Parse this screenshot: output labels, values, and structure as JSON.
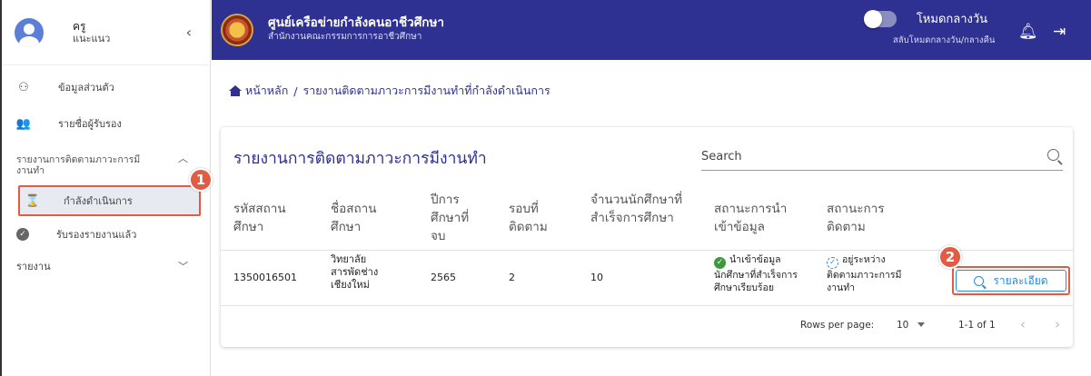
{
  "user": {
    "name": "ครู",
    "role": "แนะแนว"
  },
  "sidebar": {
    "items": [
      {
        "label": "ข้อมูลส่วนตัว",
        "icon": "user-settings-icon"
      },
      {
        "label": "รายชื่อผู้รับรอง",
        "icon": "people-icon"
      }
    ],
    "group": {
      "label": "รายงานการติดตามภาวะการมีงานทำ",
      "icon": "chevron-up-icon"
    },
    "sub_items": [
      {
        "label": "กำลังดำเนินการ",
        "icon": "hourglass-icon",
        "active": true
      },
      {
        "label": "รับรองรายงานแล้ว",
        "icon": "check-circle-icon"
      }
    ],
    "report": {
      "label": "รายงาน",
      "icon": "chevron-down-icon"
    }
  },
  "header": {
    "org_name": "ศูนย์เครือข่ายกำลังคนอาชีวศึกษา",
    "org_sub": "สำนักงานคณะกรรมการการอาชีวศึกษา",
    "mode_label": "โหมดกลางวัน",
    "mode_sub": "สลับโหมดกลางวัน/กลางคืน"
  },
  "breadcrumb": {
    "home": "หน้าหลัก",
    "separator": "/",
    "current": "รายงานติดตามภาวะการมีงานทำที่กำลังดำเนินการ"
  },
  "card": {
    "title": "รายงานการติดตามภาวะการมีงานทำ",
    "search_placeholder": "Search"
  },
  "table": {
    "headers": [
      "รหัสสถานศึกษา",
      "ชื่อสถานศึกษา",
      "ปีการศึกษาที่จบ",
      "รอบที่ติดตาม",
      "จำนวนนักศึกษาที่สำเร็จการศึกษา",
      "สถานะการนำเข้าข้อมูล",
      "สถานะการติดตาม"
    ],
    "rows": [
      {
        "code": "1350016501",
        "name": "วิทยาลัยสารพัดช่างเชียงใหม่",
        "year": "2565",
        "round": "2",
        "graduates": "10",
        "import_status": "นำเข้าข้อมูลนักศึกษาที่สำเร็จการศึกษาเรียบร้อย",
        "tracking_status": "อยู่ระหว่างติดตามภาวะการมีงานทำ",
        "detail_label": "รายละเอียด"
      }
    ],
    "footer": {
      "rows_per_page_label": "Rows per page:",
      "rows_per_page": "10",
      "range": "1-1 of 1"
    }
  },
  "annotations": {
    "step1": "1",
    "step2": "2"
  },
  "colors": {
    "header": "#2e3192",
    "accent": "#2b8ad6",
    "highlight": "#e15c43",
    "success": "#3c9a3c"
  }
}
